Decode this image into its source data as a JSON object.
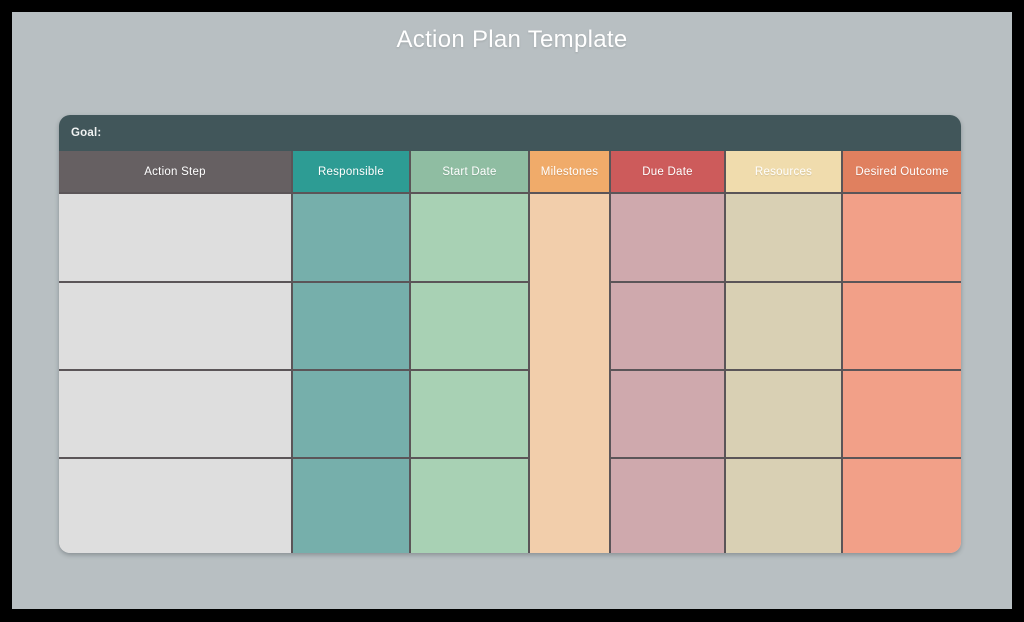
{
  "page": {
    "title": "Action Plan Template",
    "background_color": "#b8bfc2",
    "frame_color": "#000000"
  },
  "table": {
    "goal": {
      "label": "Goal:",
      "value": "",
      "bar_color": "#41565a"
    },
    "columns": [
      {
        "header": "Action Step",
        "header_color": "#666062",
        "cell_color": "#dedede",
        "merged_body": false
      },
      {
        "header": "Responsible",
        "header_color": "#2d9c94",
        "cell_color": "#76afab",
        "merged_body": false
      },
      {
        "header": "Start Date",
        "header_color": "#8fbda2",
        "cell_color": "#a8d1b4",
        "merged_body": false
      },
      {
        "header": "Milestones",
        "header_color": "#f0ab6a",
        "cell_color": "#f2ceab",
        "merged_body": true
      },
      {
        "header": "Due Date",
        "header_color": "#cd5b5b",
        "cell_color": "#cfa9ad",
        "merged_body": false
      },
      {
        "header": "Resources",
        "header_color": "#f0dcad",
        "cell_color": "#d9d0b4",
        "merged_body": false
      },
      {
        "header": "Desired Outcome",
        "header_color": "#e0805f",
        "cell_color": "#f2a088",
        "merged_body": false
      }
    ],
    "rows": [
      {
        "action_step": "",
        "responsible": "",
        "start_date": "",
        "due_date": "",
        "resources": "",
        "desired_outcome": ""
      },
      {
        "action_step": "",
        "responsible": "",
        "start_date": "",
        "due_date": "",
        "resources": "",
        "desired_outcome": ""
      },
      {
        "action_step": "",
        "responsible": "",
        "start_date": "",
        "due_date": "",
        "resources": "",
        "desired_outcome": ""
      },
      {
        "action_step": "",
        "responsible": "",
        "start_date": "",
        "due_date": "",
        "resources": "",
        "desired_outcome": ""
      }
    ],
    "milestones_cell": "",
    "row_count": 4,
    "border_color": "#5b5558"
  }
}
